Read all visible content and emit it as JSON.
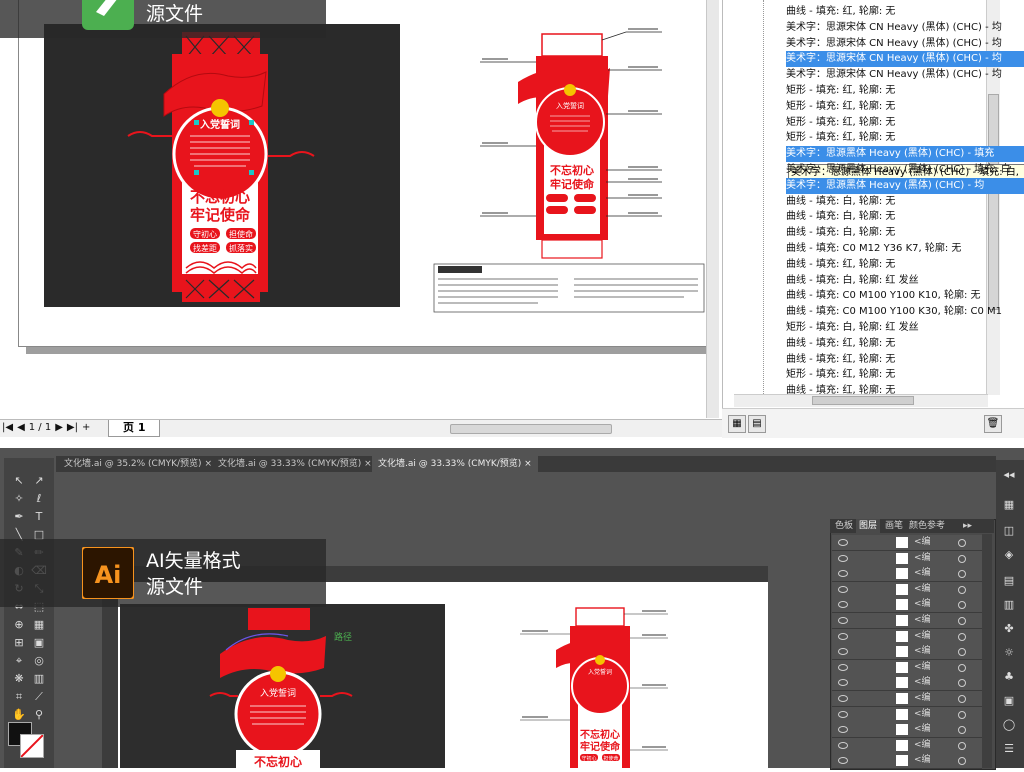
{
  "top": {
    "badge": {
      "line2": "源文件"
    },
    "pager": {
      "first": "|◀",
      "prev": "◀",
      "count": "1 / 1",
      "next": "▶",
      "last": "▶|",
      "add": "+"
    },
    "page_tab": "页 1",
    "objects": [
      {
        "label": "曲线 - 填充: 红, 轮廓: 无",
        "icon": "curve-icon",
        "selected": false
      },
      {
        "label": "美术字：思源宋体 CN Heavy (黑体) (CHC) - 均",
        "icon": "artistic-text-icon",
        "selected": false
      },
      {
        "label": "美术字：思源宋体 CN Heavy (黑体) (CHC) - 均",
        "icon": "artistic-text-icon",
        "selected": false
      },
      {
        "label": "美术字：思源宋体 CN Heavy (黑体) (CHC) - 均",
        "icon": "artistic-text-icon",
        "selected": true
      },
      {
        "label": "美术字：思源宋体 CN Heavy (黑体) (CHC) - 均",
        "icon": "artistic-text-icon",
        "selected": false
      },
      {
        "label": "矩形 - 填充: 红, 轮廓: 无",
        "icon": "rectangle-icon",
        "selected": false
      },
      {
        "label": "矩形 - 填充: 红, 轮廓: 无",
        "icon": "rectangle-icon",
        "selected": false
      },
      {
        "label": "矩形 - 填充: 红, 轮廓: 无",
        "icon": "rectangle-icon",
        "selected": false
      },
      {
        "label": "矩形 - 填充: 红, 轮廓: 无",
        "icon": "rectangle-icon",
        "selected": false
      },
      {
        "label": "美术字：思源黑体 Heavy (黑体) (CHC) - 填充",
        "icon": "artistic-text-icon",
        "selected": true
      },
      {
        "label": "美术字：思源黑体 Heavy (黑体) (CHC) - 填充: 白",
        "icon": "artistic-text-icon",
        "selected": false
      },
      {
        "label": "美术字：思源黑体 Heavy (黑体) (CHC) - 均",
        "icon": "artistic-text-icon",
        "selected": true
      },
      {
        "label": "曲线 - 填充: 白, 轮廓: 无",
        "icon": "curve-icon",
        "selected": false
      },
      {
        "label": "曲线 - 填充: 白, 轮廓: 无",
        "icon": "curve-icon",
        "selected": false
      },
      {
        "label": "曲线 - 填充: 白, 轮廓: 无",
        "icon": "curve-icon",
        "selected": false
      },
      {
        "label": "曲线 - 填充: C0 M12 Y36 K7, 轮廓: 无",
        "icon": "curve-icon",
        "selected": false
      },
      {
        "label": "曲线 - 填充: 红, 轮廓: 无",
        "icon": "curve-icon",
        "selected": false
      },
      {
        "label": "曲线 - 填充: 白, 轮廓: 红 发丝",
        "icon": "curve-icon",
        "selected": false
      },
      {
        "label": "曲线 - 填充: C0 M100 Y100 K10, 轮廓: 无",
        "icon": "curve-icon",
        "selected": false
      },
      {
        "label": "曲线 - 填充: C0 M100 Y100 K30, 轮廓: C0 M1",
        "icon": "curve-icon",
        "selected": false
      },
      {
        "label": "矩形 - 填充: 白, 轮廓: 红 发丝",
        "icon": "rectangle-outline-icon",
        "selected": false
      },
      {
        "label": "曲线 - 填充: 红, 轮廓: 无",
        "icon": "curve-icon",
        "selected": false
      },
      {
        "label": "曲线 - 填充: 红, 轮廓: 无",
        "icon": "curve-icon",
        "selected": false
      },
      {
        "label": "矩形 - 填充: 红, 轮廓: 无",
        "icon": "rectangle-icon",
        "selected": false
      },
      {
        "label": "曲线 - 填充: 红, 轮廓: 无",
        "icon": "curve-icon",
        "selected": false
      }
    ],
    "tooltip": "美术字：思源黑体 Heavy (黑体) (CHC) - 填充: 白,",
    "art": {
      "main_title_1": "不忘初心",
      "main_title_2": "牢记使命",
      "circle_title": "入党誓词",
      "pill_1": "守初心",
      "pill_2": "担使命",
      "pill_3": "找差距",
      "pill_4": "抓落实"
    }
  },
  "bottom": {
    "badge": {
      "line1": "AI矢量格式",
      "line2": "源文件",
      "logo_text": "Ai"
    },
    "tabs": [
      {
        "label": "文化墙.ai @ 35.2% (CMYK/预览)",
        "close": "×",
        "active": false
      },
      {
        "label": "文化墙.ai @ 33.33% (CMYK/预览)",
        "close": "×",
        "active": false
      },
      {
        "label": "文化墙.ai @ 33.33% (CMYK/预览)",
        "close": "×",
        "active": true
      }
    ],
    "panel_tabs": [
      "色板",
      "图层",
      "画笔",
      "颜色参考"
    ],
    "panel_active_tab": "图层",
    "panel_menu": "▸▸",
    "layer_name": "<编",
    "path_label": "路径",
    "art": {
      "main_title_1": "不忘初心",
      "main_title_2": "牢记使命",
      "circle_title": "入党誓词",
      "pill_1": "守初心",
      "pill_2": "担使命"
    }
  },
  "colors": {
    "accent_red": "#e8141c",
    "selection_blue": "#3b8ee8",
    "ai_orange": "#f7931e",
    "ai_dark": "#2c1500",
    "cdr_green": "#4caf50"
  }
}
